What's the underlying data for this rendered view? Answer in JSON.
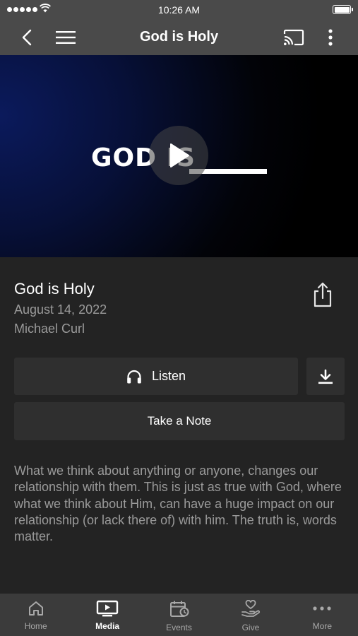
{
  "status_bar": {
    "time": "10:26 AM"
  },
  "nav": {
    "title": "God is Holy"
  },
  "video": {
    "overlay_text": "GOD IS"
  },
  "sermon": {
    "title": "God is Holy",
    "date": "August 14, 2022",
    "speaker": "Michael Curl",
    "description": "What we think about anything or anyone, changes our relationship with them. This is just as true with God, where what we think about Him, can have a huge impact on our relationship (or lack there of) with him. The truth is, words matter."
  },
  "actions": {
    "listen_label": "Listen",
    "note_label": "Take a Note"
  },
  "tabs": [
    {
      "label": "Home",
      "icon": "home-icon"
    },
    {
      "label": "Media",
      "icon": "media-icon",
      "active": true
    },
    {
      "label": "Events",
      "icon": "events-icon"
    },
    {
      "label": "Give",
      "icon": "give-icon"
    },
    {
      "label": "More",
      "icon": "more-icon"
    }
  ],
  "colors": {
    "bar_bg": "#4a4a4a",
    "page_bg": "#232323",
    "button_bg": "#2f2f2f",
    "muted_text": "#9a9a9a",
    "tab_bar_bg": "#3b3b3b"
  }
}
